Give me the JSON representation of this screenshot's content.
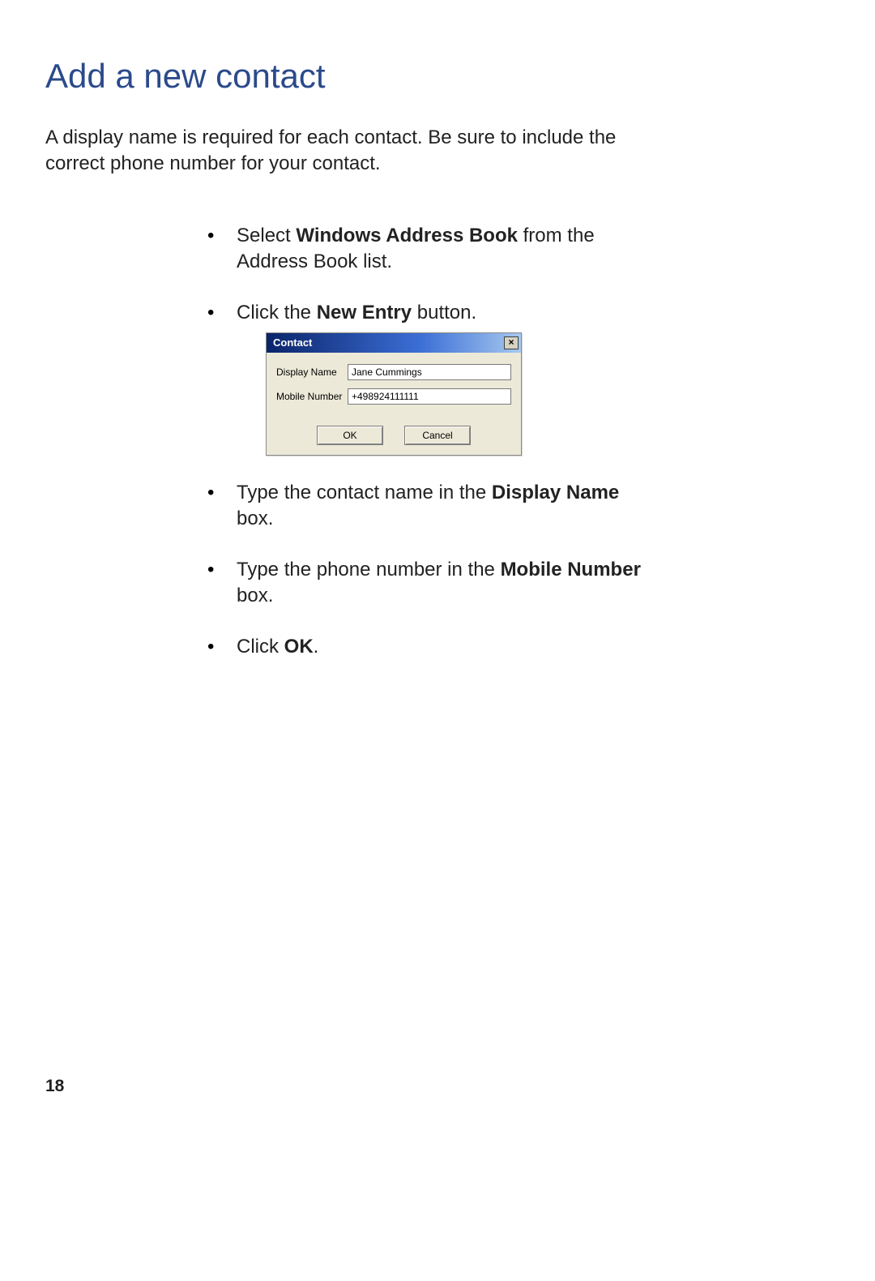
{
  "title": "Add a new contact",
  "intro": "A display name is required for each contact. Be sure to include the correct phone number for your contact.",
  "steps": {
    "item1": {
      "pre": "Select ",
      "bold": "Windows Address Book",
      "post": " from the Address Book list."
    },
    "item2": {
      "pre": "Click the ",
      "bold": "New Entry",
      "post": " button."
    },
    "item3": {
      "pre": "Type the contact name in the ",
      "bold": "Display Name",
      "post": " box."
    },
    "item4": {
      "pre": "Type the phone number in the ",
      "bold": "Mobile Number",
      "post": " box."
    },
    "item5": {
      "pre": "Click ",
      "bold": "OK",
      "post": "."
    }
  },
  "dialog": {
    "title": "Contact",
    "close_glyph": "×",
    "display_name_label": "Display Name",
    "display_name_value": "Jane Cummings",
    "mobile_number_label": "Mobile Number",
    "mobile_number_value": "+498924111111",
    "ok_label": "OK",
    "cancel_label": "Cancel"
  },
  "page_number": "18"
}
